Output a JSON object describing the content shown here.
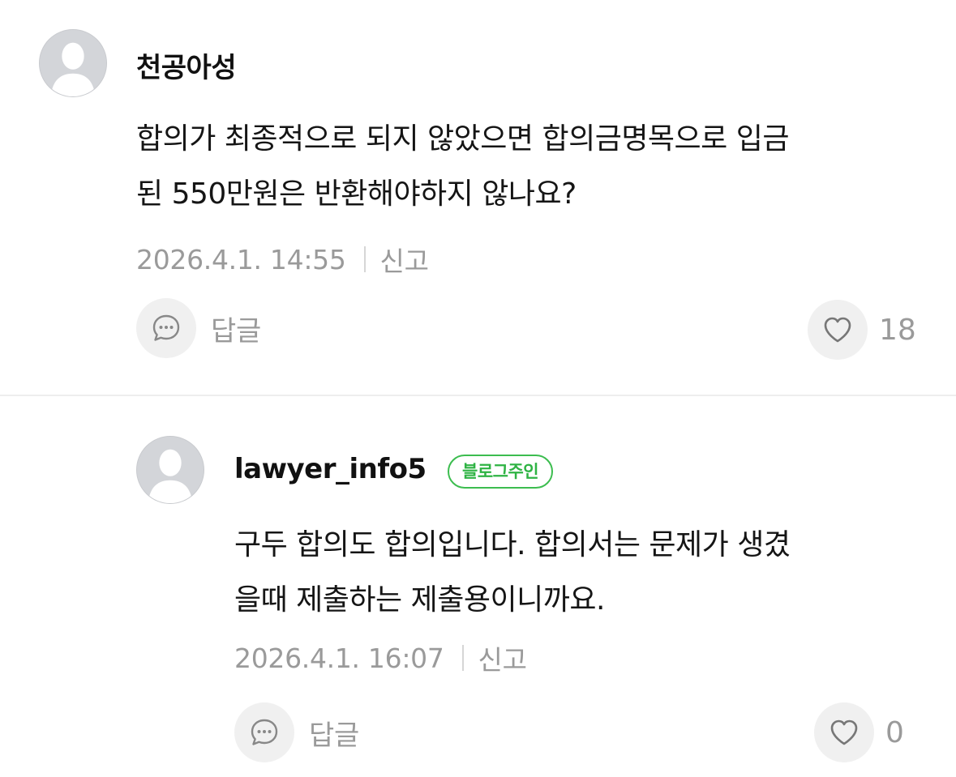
{
  "comments": [
    {
      "author": "천공아성",
      "text_lines": [
        "합의가 최종적으로 되지 않았으면 합의금명목으로 입금",
        "된 550만원은 반환해야하지 않나요?"
      ],
      "date": "2026.4.1. 14:55",
      "report_label": "신고",
      "reply_label": "답글",
      "like_count": "18"
    },
    {
      "author": "lawyer_info5",
      "badge": "블로그주인",
      "text_lines": [
        "구두 합의도 합의입니다. 합의서는 문제가 생겼",
        "을때 제출하는 제출용이니까요."
      ],
      "date": "2026.4.1. 16:07",
      "report_label": "신고",
      "reply_label": "답글",
      "like_count": "0"
    }
  ],
  "icons": {
    "avatar": "default-user-avatar-icon",
    "reply": "speech-bubble-icon",
    "like": "heart-outline-icon"
  },
  "colors": {
    "badge_green": "#2fb344",
    "meta_gray": "#9a9a9a",
    "button_bg": "#f0f0f0",
    "divider": "#eeeeee"
  }
}
